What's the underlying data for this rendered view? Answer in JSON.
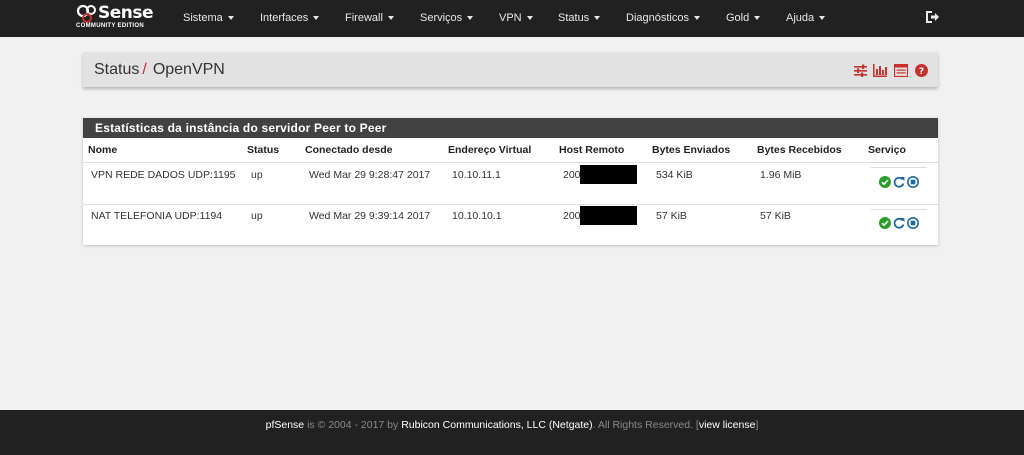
{
  "brand": {
    "name": "pfSense",
    "logo_text": "Sense",
    "logo_subtitle": "COMMUNITY EDITION"
  },
  "nav": [
    {
      "label": "Sistema"
    },
    {
      "label": "Interfaces"
    },
    {
      "label": "Firewall"
    },
    {
      "label": "Serviços"
    },
    {
      "label": "VPN"
    },
    {
      "label": "Status"
    },
    {
      "label": "Diagnósticos"
    },
    {
      "label": "Gold"
    },
    {
      "label": "Ajuda"
    }
  ],
  "breadcrumb": {
    "parent": "Status",
    "separator": "/",
    "current": "OpenVPN"
  },
  "panel": {
    "title": "Estatísticas da instância do servidor Peer to Peer",
    "columns": [
      "Nome",
      "Status",
      "Conectado desde",
      "Endereço Virtual",
      "Host Remoto",
      "Bytes Enviados",
      "Bytes Recebidos",
      "Serviço"
    ],
    "rows": [
      {
        "name": "VPN REDE DADOS UDP:1195",
        "status": "up",
        "since": "Wed Mar 29 9:28:47 2017",
        "virtual": "10.10.11.1",
        "remote": "200",
        "sent": "534 KiB",
        "received": "1.96 MiB"
      },
      {
        "name": "NAT TELEFONIA UDP:1194",
        "status": "up",
        "since": "Wed Mar 29 9:39:14 2017",
        "virtual": "10.10.10.1",
        "remote": "200.",
        "sent": "57 KiB",
        "received": "57 KiB"
      }
    ]
  },
  "footer": {
    "brand": "pfSense",
    "is": "is © 2004 - 2017 by",
    "company": "Rubicon Communications, LLC (Netgate)",
    "rights": ". All Rights Reserved. [",
    "license": "view license",
    "close": "]"
  },
  "colors": {
    "navbar": "#212121",
    "accent_red": "#c9302c",
    "running_green": "#2a9d2a",
    "action_blue": "#1c6aa8"
  }
}
